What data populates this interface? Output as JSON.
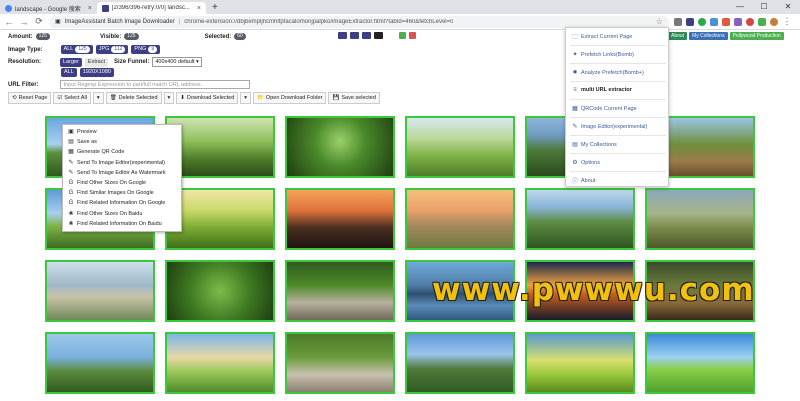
{
  "browser": {
    "tabs": [
      {
        "title": "landscape - Google 搜索",
        "favicon_color": "#4285f4"
      },
      {
        "title": "[2/396/396-retry:0/0] landsc...",
        "favicon_color": "#3d3f84"
      }
    ],
    "new_tab": "+",
    "window_controls": {
      "minimize": "—",
      "maximize": "☐",
      "close": "✕"
    },
    "omnibox": {
      "site": "ImageAssistant Batch Image Downloader",
      "separator": "|",
      "url": "chrome-extension://dbjbempljhcmhlfpfacalomonjpalpko/imageExtractor.html?tabId=460&fetchLevel=0"
    }
  },
  "summary": {
    "amount_label": "Amount:",
    "amount": "125",
    "visible_label": "Visible:",
    "visible": "125",
    "selected_label": "Selected:",
    "selected": "60"
  },
  "filters": {
    "image_type_label": "Image Type:",
    "types": [
      {
        "label": "ALL",
        "count": "125"
      },
      {
        "label": "JPG",
        "count": "112"
      },
      {
        "label": "PNG",
        "count": "9"
      }
    ],
    "resolution_label": "Resolution:",
    "resolution_opts": [
      "Larger",
      "Extract"
    ],
    "size_funnel_label": "Size Funnel:",
    "size_funnel_value": "400x400 default",
    "resolution_chips": [
      "ALL",
      "1920X1080"
    ],
    "url_filter_label": "URL Filter:",
    "url_filter_placeholder": "Input Regexp Expression to part/full match URL address."
  },
  "actions": [
    {
      "label": "Reset Page",
      "icon": "⟲"
    },
    {
      "label": "Select All",
      "icon": "☑",
      "dropdown": true
    },
    {
      "label": "Delete Selected",
      "icon": "🗑",
      "dropdown": true
    },
    {
      "label": "Download Selected",
      "icon": "⬇",
      "dropdown": true
    },
    {
      "label": "Open Download Folder",
      "icon": "📁"
    },
    {
      "label": "Save selected",
      "icon": "💾"
    }
  ],
  "right_tabs": [
    {
      "label": "About",
      "color": "#2e8b57"
    },
    {
      "label": "My Collections",
      "color": "#3b6fb6"
    },
    {
      "label": "Pollywood Production",
      "color": "#4caf50"
    }
  ],
  "context_menu": [
    {
      "label": "Preview",
      "icon": "▣"
    },
    {
      "label": "Save as",
      "icon": "▤"
    },
    {
      "label": "Generate QR Code",
      "icon": "▦"
    },
    {
      "label": "Send To Image Editor(experimental)",
      "icon": "✎"
    },
    {
      "label": "Send To Image Editor As Watermark",
      "icon": "✎"
    },
    {
      "label": "Find Other Sizes On Google",
      "icon": "G"
    },
    {
      "label": "Find Similar Images On Google",
      "icon": "G"
    },
    {
      "label": "Find Related Information On Google",
      "icon": "G"
    },
    {
      "label": "Find Other Sizes On Baidu",
      "icon": "❀"
    },
    {
      "label": "Find Related Information On Baidu",
      "icon": "❀"
    }
  ],
  "popup_menu": [
    {
      "label": "Extract Current Page",
      "icon": "⬚",
      "bold": false
    },
    {
      "label": "Prefetch Links(Bomb)",
      "icon": "✦",
      "bold": false
    },
    {
      "label": "Analyze Prefetch(Bomb+)",
      "icon": "✸",
      "bold": false
    },
    {
      "label": "multi URL extractor",
      "icon": "≡",
      "bold": true
    },
    {
      "label": "QRCode Current Page",
      "icon": "▦",
      "bold": false
    },
    {
      "label": "Image Editor(experimental)",
      "icon": "✎",
      "bold": false
    },
    {
      "label": "My Collections",
      "icon": "▤",
      "bold": false
    },
    {
      "label": "Options",
      "icon": "⚙",
      "bold": false
    },
    {
      "label": "About",
      "icon": "ⓘ",
      "bold": false
    }
  ],
  "watermark": "www.pwwwu.com"
}
